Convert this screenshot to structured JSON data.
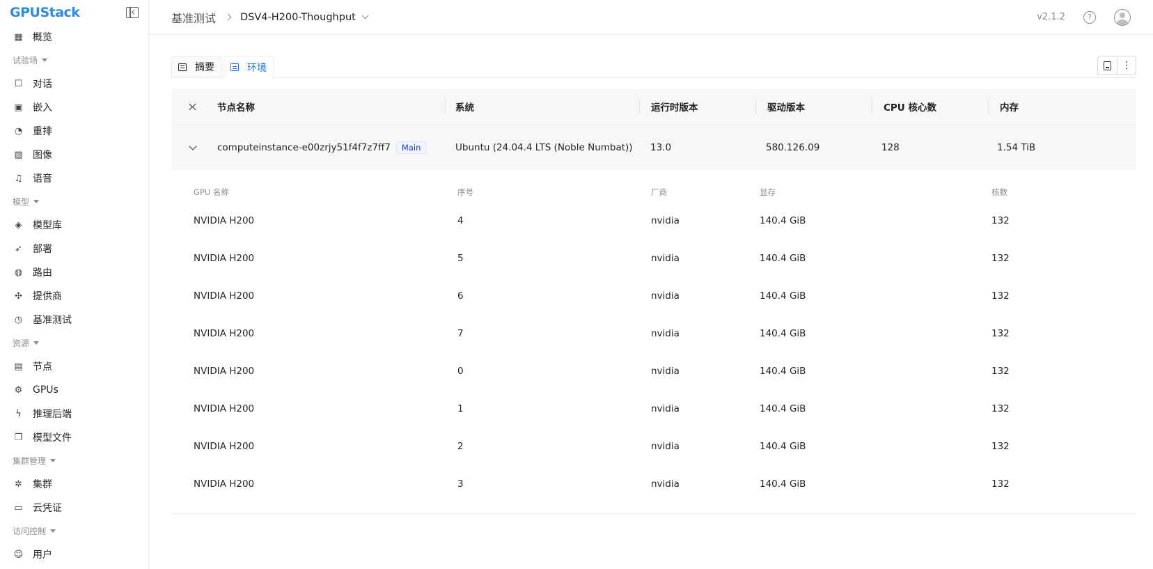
{
  "brand": {
    "name": "GPUStack"
  },
  "sidebar": {
    "items": [
      {
        "type": "item",
        "label": "概览",
        "icon": "dashboard-icon"
      },
      {
        "type": "group",
        "label": "试验场"
      },
      {
        "type": "item",
        "label": "对话",
        "icon": "chat-icon"
      },
      {
        "type": "item",
        "label": "嵌入",
        "icon": "embedding-icon"
      },
      {
        "type": "item",
        "label": "重排",
        "icon": "rerank-icon"
      },
      {
        "type": "item",
        "label": "图像",
        "icon": "image-icon"
      },
      {
        "type": "item",
        "label": "语音",
        "icon": "audio-icon"
      },
      {
        "type": "group",
        "label": "模型"
      },
      {
        "type": "item",
        "label": "模型库",
        "icon": "layers-icon"
      },
      {
        "type": "item",
        "label": "部署",
        "icon": "rocket-icon"
      },
      {
        "type": "item",
        "label": "路由",
        "icon": "globe-icon"
      },
      {
        "type": "item",
        "label": "提供商",
        "icon": "puzzle-icon"
      },
      {
        "type": "item",
        "label": "基准测试",
        "icon": "gauge-icon"
      },
      {
        "type": "group",
        "label": "资源"
      },
      {
        "type": "item",
        "label": "节点",
        "icon": "server-icon"
      },
      {
        "type": "item",
        "label": "GPUs",
        "icon": "chip-icon"
      },
      {
        "type": "item",
        "label": "推理后端",
        "icon": "bolt-icon"
      },
      {
        "type": "item",
        "label": "模型文件",
        "icon": "files-icon"
      },
      {
        "type": "group",
        "label": "集群管理"
      },
      {
        "type": "item",
        "label": "集群",
        "icon": "cluster-icon"
      },
      {
        "type": "item",
        "label": "云凭证",
        "icon": "credential-icon"
      },
      {
        "type": "group",
        "label": "访问控制"
      },
      {
        "type": "item",
        "label": "用户",
        "icon": "users-icon"
      }
    ]
  },
  "header": {
    "breadcrumb_root": "基准测试",
    "breadcrumb_current": "DSV4-H200-Thoughput",
    "version": "v2.1.2"
  },
  "tabs": [
    {
      "label": "摘要",
      "active": false
    },
    {
      "label": "环境",
      "active": true
    }
  ],
  "table": {
    "columns": [
      "节点名称",
      "系统",
      "运行时版本",
      "驱动版本",
      "CPU 核心数",
      "内存"
    ],
    "node": {
      "name": "computeinstance-e00zrjy51f4f7z7ff7",
      "badge": "Main",
      "os": "Ubuntu (24.04.4 LTS (Noble Numbat))",
      "runtime": "13.0",
      "driver": "580.126.09",
      "cpu": "128",
      "memory": "1.54 TiB"
    },
    "gpu_columns": [
      "GPU 名称",
      "序号",
      "厂商",
      "显存",
      "核数"
    ],
    "gpus": [
      {
        "name": "NVIDIA H200",
        "index": "4",
        "vendor": "nvidia",
        "vram": "140.4 GiB",
        "cores": "132"
      },
      {
        "name": "NVIDIA H200",
        "index": "5",
        "vendor": "nvidia",
        "vram": "140.4 GiB",
        "cores": "132"
      },
      {
        "name": "NVIDIA H200",
        "index": "6",
        "vendor": "nvidia",
        "vram": "140.4 GiB",
        "cores": "132"
      },
      {
        "name": "NVIDIA H200",
        "index": "7",
        "vendor": "nvidia",
        "vram": "140.4 GiB",
        "cores": "132"
      },
      {
        "name": "NVIDIA H200",
        "index": "0",
        "vendor": "nvidia",
        "vram": "140.4 GiB",
        "cores": "132"
      },
      {
        "name": "NVIDIA H200",
        "index": "1",
        "vendor": "nvidia",
        "vram": "140.4 GiB",
        "cores": "132"
      },
      {
        "name": "NVIDIA H200",
        "index": "2",
        "vendor": "nvidia",
        "vram": "140.4 GiB",
        "cores": "132"
      },
      {
        "name": "NVIDIA H200",
        "index": "3",
        "vendor": "nvidia",
        "vram": "140.4 GiB",
        "cores": "132"
      }
    ]
  },
  "colors": {
    "accent": "#1677ff",
    "badge_text": "#1d39c4",
    "logo": "#2b8ce6"
  }
}
